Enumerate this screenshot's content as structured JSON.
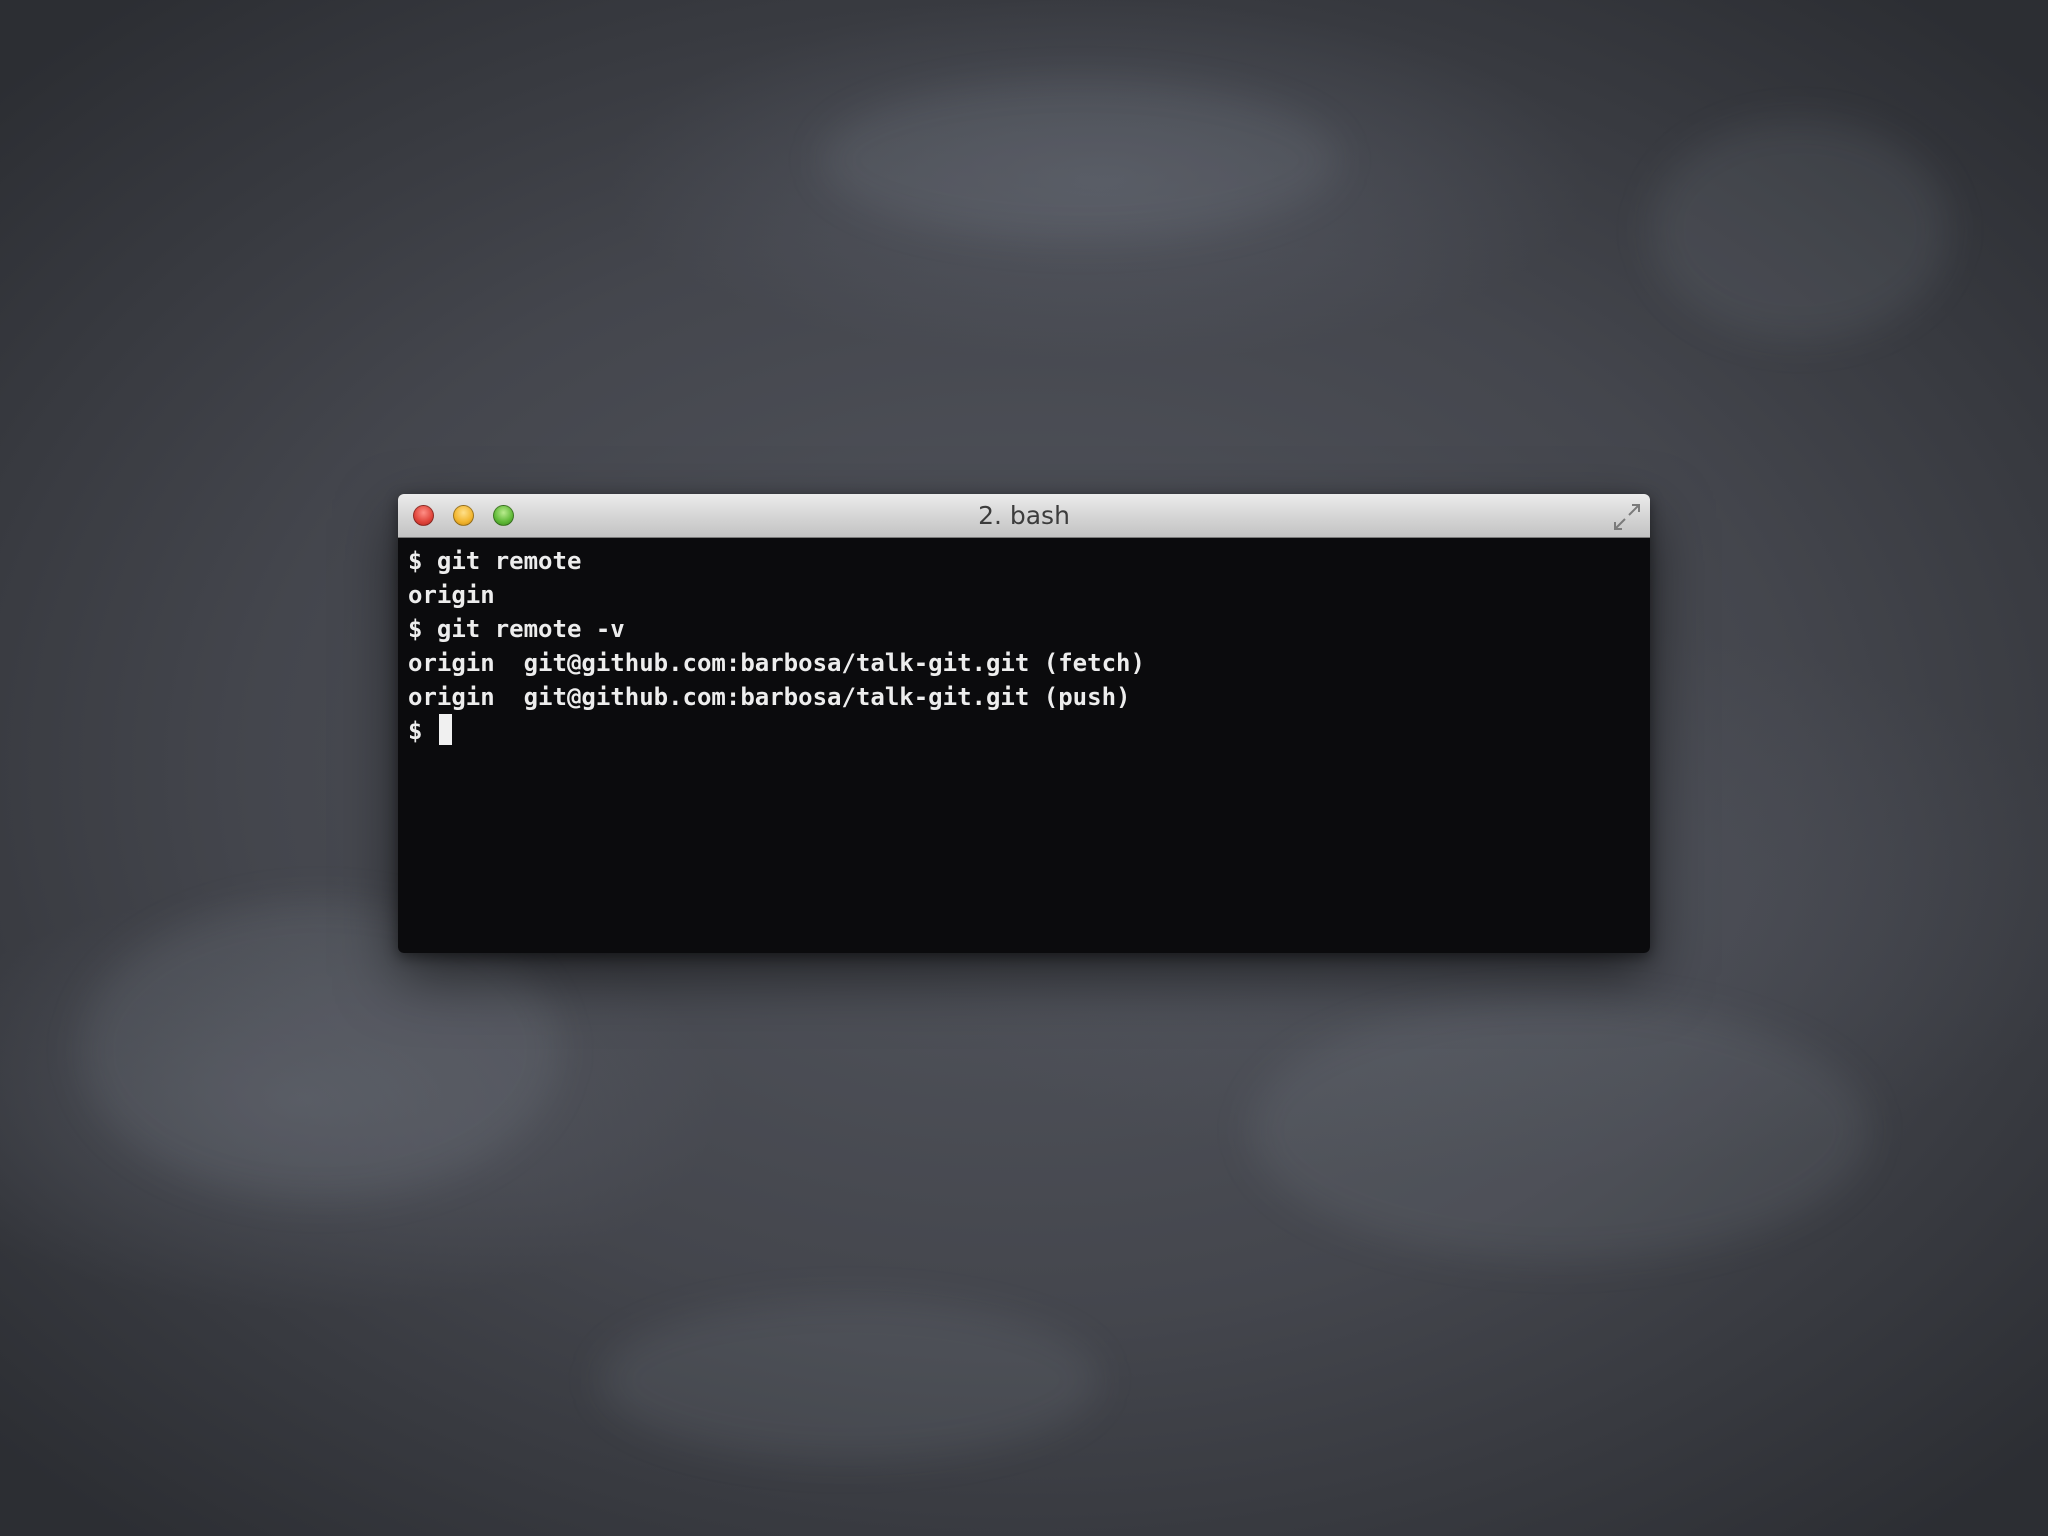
{
  "window": {
    "title": "2. bash"
  },
  "terminal": {
    "lines": [
      "$ git remote",
      "origin",
      "$ git remote -v",
      "origin  git@github.com:barbosa/talk-git.git (fetch)",
      "origin  git@github.com:barbosa/talk-git.git (push)"
    ],
    "prompt": "$ "
  },
  "icons": {
    "close": "close-icon",
    "minimize": "minimize-icon",
    "zoom": "zoom-icon",
    "fullscreen": "fullscreen-icon"
  },
  "colors": {
    "close": "#e0443a",
    "minimize": "#f2b52e",
    "zoom": "#5fb937",
    "terminal_bg": "#0b0b0d",
    "terminal_fg": "#ededed"
  }
}
